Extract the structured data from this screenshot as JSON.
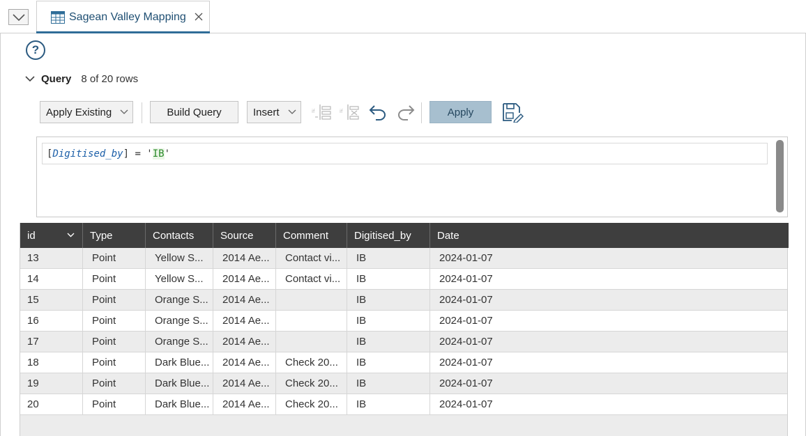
{
  "tab": {
    "title": "Sagean Valley Mapping",
    "icon": "table-icon"
  },
  "help": {
    "glyph": "?"
  },
  "query": {
    "label": "Query",
    "count": "8 of 20 rows"
  },
  "toolbar": {
    "apply_existing": "Apply Existing",
    "build_query": "Build Query",
    "insert": "Insert",
    "apply": "Apply"
  },
  "editor": {
    "open_bracket": "[",
    "field": "Digitised_by",
    "close_bracket_op": "] = '",
    "value": "IB",
    "close_quote": "'"
  },
  "table": {
    "columns": [
      "id",
      "Type",
      "Contacts",
      "Source",
      "Comment",
      "Digitised_by",
      "Date"
    ],
    "rows": [
      [
        "13",
        "Point",
        "Yellow S...",
        "2014 Ae...",
        "Contact vi...",
        "IB",
        "2024-01-07"
      ],
      [
        "14",
        "Point",
        "Yellow S...",
        "2014 Ae...",
        "Contact vi...",
        "IB",
        "2024-01-07"
      ],
      [
        "15",
        "Point",
        "Orange S...",
        "2014 Ae...",
        "",
        "IB",
        "2024-01-07"
      ],
      [
        "16",
        "Point",
        "Orange S...",
        "2014 Ae...",
        "",
        "IB",
        "2024-01-07"
      ],
      [
        "17",
        "Point",
        "Orange S...",
        "2014 Ae...",
        "",
        "IB",
        "2024-01-07"
      ],
      [
        "18",
        "Point",
        "Dark Blue...",
        "2014 Ae...",
        "Check 20...",
        "IB",
        "2024-01-07"
      ],
      [
        "19",
        "Point",
        "Dark Blue...",
        "2014 Ae...",
        "Check 20...",
        "IB",
        "2024-01-07"
      ],
      [
        "20",
        "Point",
        "Dark Blue...",
        "2014 Ae...",
        "Check 20...",
        "IB",
        "2024-01-07"
      ]
    ]
  },
  "colors": {
    "accent": "#2f6d98",
    "header_bg": "#3e3e3e",
    "apply_bg": "#a7bfcf"
  }
}
